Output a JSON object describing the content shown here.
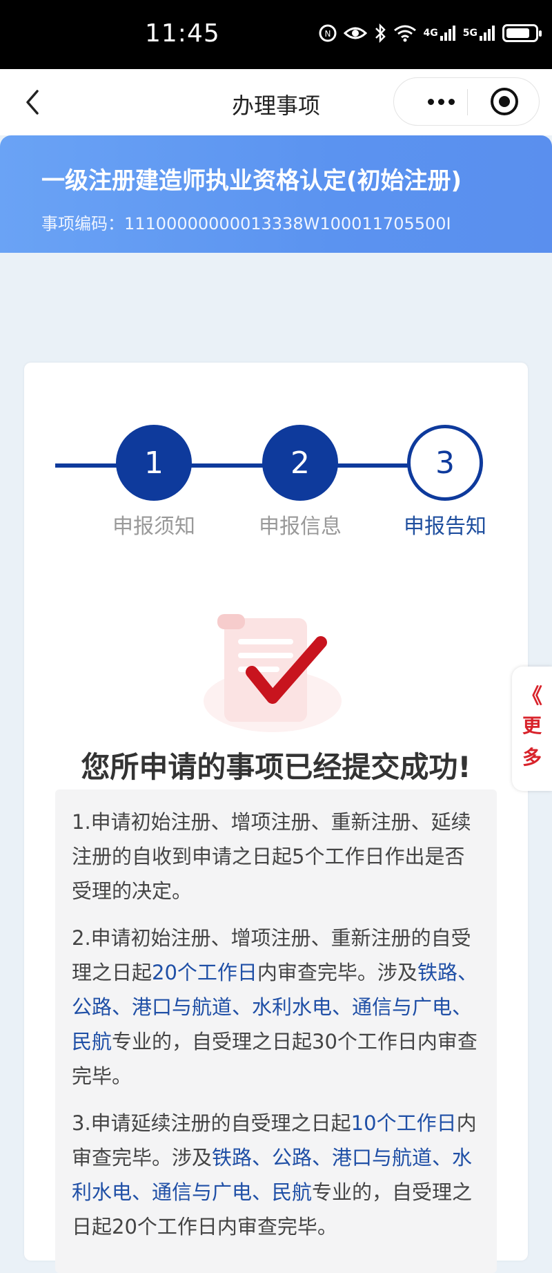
{
  "status_bar": {
    "time": "11:45",
    "signal_4g": "4G",
    "signal_5g": "5G"
  },
  "nav": {
    "title": "办理事项"
  },
  "banner": {
    "item_name": "一级注册建造师执业资格认定(初始注册)",
    "code_label": "事项编码：",
    "code_value": "11100000000013338W100011705500I"
  },
  "steps": [
    {
      "number": "1",
      "label": "申报须知",
      "state": "done"
    },
    {
      "number": "2",
      "label": "申报信息",
      "state": "done"
    },
    {
      "number": "3",
      "label": "申报告知",
      "state": "current"
    }
  ],
  "success_title": "您所申请的事项已经提交成功!",
  "notice": {
    "p1": "1.申请初始注册、增项注册、重新注册、延续注册的自收到申请之日起5个工作日作出是否受理的决定。",
    "p2_a": "2.申请初始注册、增项注册、重新注册的自受理之日起",
    "p2_b": "20个工作日",
    "p2_c": "内审查完毕。涉及",
    "p2_d": "铁路、公路、港口与航道、水利水电、通信与广电、民航",
    "p2_e": "专业的，自受理之日起30个工作日内审查完毕。",
    "p3_a": "3.申请延续注册的自受理之日起",
    "p3_b": "10个工作日",
    "p3_c": "内审查完毕。涉及",
    "p3_d": "铁路、公路、港口与航道、水利水电、通信与广电、民航",
    "p3_e": "专业的，自受理之日起20个工作日内审查完毕。"
  },
  "side_more": {
    "chevron": "《",
    "label_1": "更",
    "label_2": "多"
  },
  "colors": {
    "primary": "#0e3a9c",
    "highlight": "#1f4fa6",
    "banner": "#5b93f0",
    "accent_red": "#d8222a"
  }
}
